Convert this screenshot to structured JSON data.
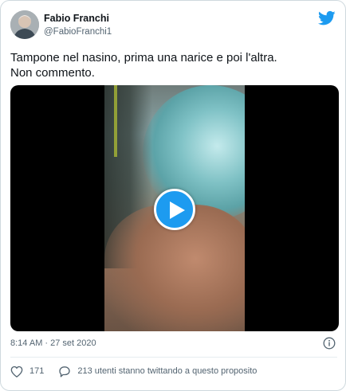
{
  "author": {
    "name": "Fabio Franchi",
    "handle": "@FabioFranchi1"
  },
  "tweet": {
    "text": "Tampone nel nasino, prima una narice e poi l'altra.\nNon commento."
  },
  "meta": {
    "timestamp": "8:14 AM · 27 set 2020"
  },
  "actions": {
    "likes": "171",
    "conversation": "213 utenti stanno twittando a questo proposito"
  },
  "colors": {
    "accent": "#1d9bf0",
    "text": "#0f1419",
    "muted": "#536471",
    "border": "#cfd9de"
  },
  "icons": {
    "logo": "twitter-bird-icon",
    "play": "play-icon",
    "info": "info-icon",
    "like": "heart-icon",
    "reply": "speech-bubble-icon"
  }
}
